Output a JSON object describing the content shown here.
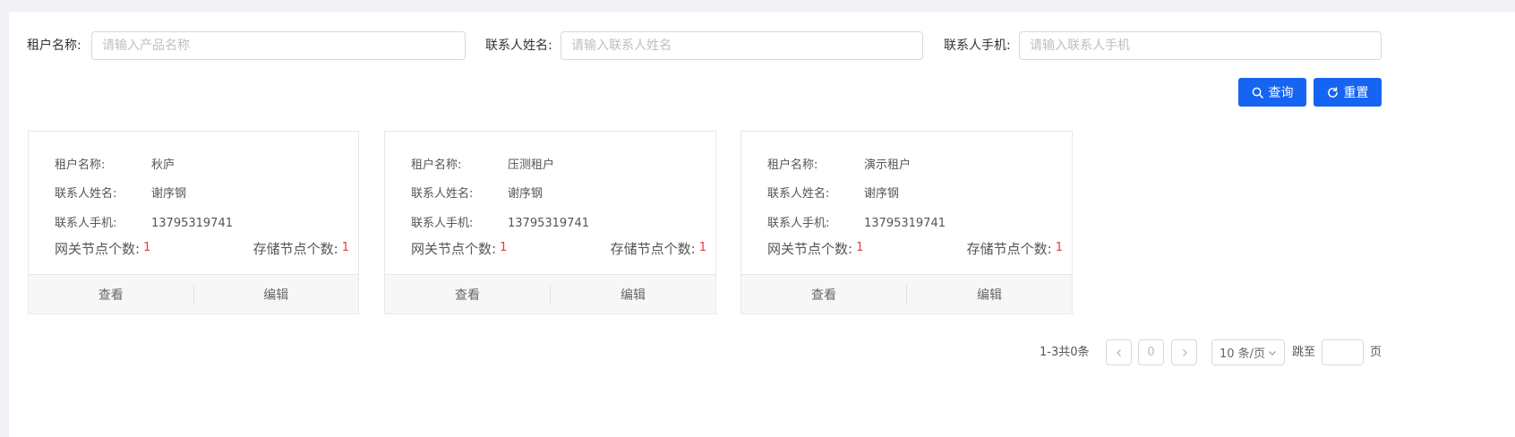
{
  "filters": {
    "tenant_label": "租户名称:",
    "tenant_placeholder": "请输入产品名称",
    "contact_name_label": "联系人姓名:",
    "contact_name_placeholder": "请输入联系人姓名",
    "contact_phone_label": "联系人手机:",
    "contact_phone_placeholder": "请输入联系人手机"
  },
  "buttons": {
    "query": "查询",
    "reset": "重置"
  },
  "card_labels": {
    "tenant": "租户名称:",
    "contact_name": "联系人姓名:",
    "contact_phone": "联系人手机:",
    "gateway_nodes": "网关节点个数:",
    "storage_nodes": "存储节点个数:",
    "view": "查看",
    "edit": "编辑"
  },
  "cards": [
    {
      "tenant": "秋庐",
      "contact_name": "谢序钢",
      "contact_phone": "13795319741",
      "gateway_nodes": "1",
      "storage_nodes": "1"
    },
    {
      "tenant": "压测租户",
      "contact_name": "谢序钢",
      "contact_phone": "13795319741",
      "gateway_nodes": "1",
      "storage_nodes": "1"
    },
    {
      "tenant": "演示租户",
      "contact_name": "谢序钢",
      "contact_phone": "13795319741",
      "gateway_nodes": "1",
      "storage_nodes": "1"
    }
  ],
  "pagination": {
    "summary": "1-3共0条",
    "current_page": "0",
    "prev_icon": "chevron-left-icon",
    "next_icon": "chevron-right-icon",
    "page_size": "10 条/页",
    "jump_label": "跳至",
    "jump_value": "",
    "page_suffix": "页"
  },
  "colors": {
    "primary": "#1565f2",
    "count": "#e53935",
    "background": "#f0f2f5"
  }
}
